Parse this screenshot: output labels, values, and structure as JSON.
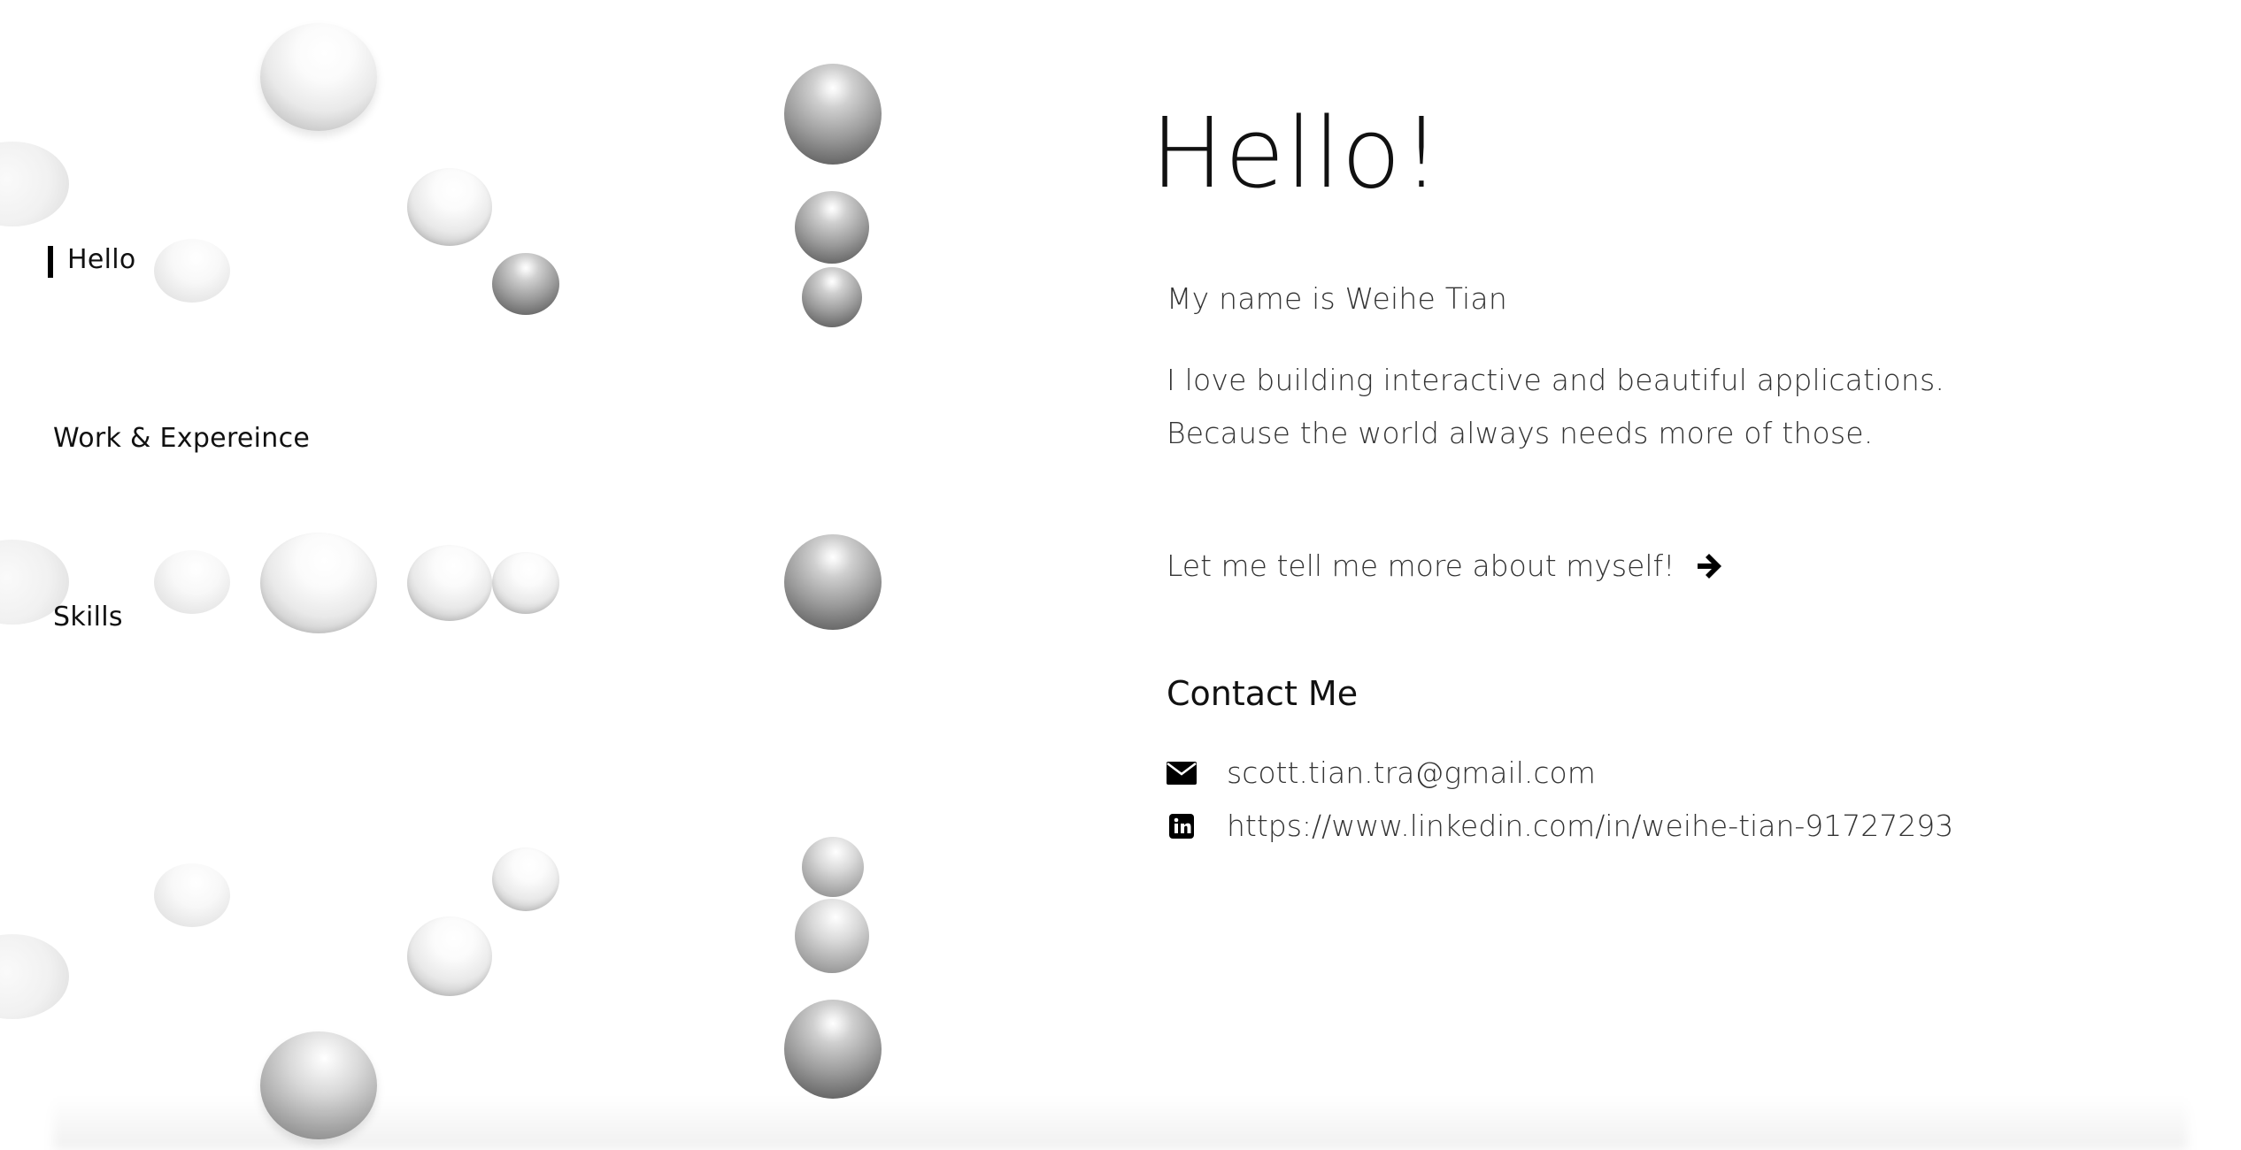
{
  "nav": {
    "items": [
      {
        "label": "Hello",
        "active": true
      },
      {
        "label": "Work & Expereince",
        "active": false
      },
      {
        "label": "Skills",
        "active": false
      }
    ]
  },
  "main": {
    "title": "Hello!",
    "intro_name": "My name is Weihe Tian",
    "intro_line_1": "I love building interactive and beautiful applications.",
    "intro_line_2": "Because the world always needs more of those.",
    "cta_label": "Let me tell me more about myself!",
    "cta_icon": "arrow-right-icon"
  },
  "contact": {
    "heading": "Contact Me",
    "email": {
      "icon": "envelope-icon",
      "text": "scott.tian.tra@gmail.com"
    },
    "linkedin": {
      "icon": "linkedin-icon",
      "text": "https://www.linkedin.com/in/weihe-tian-91727293"
    }
  },
  "colors": {
    "background": "#ffffff",
    "text_primary": "#111111",
    "text_secondary": "#333333",
    "active_indicator": "#000000"
  }
}
